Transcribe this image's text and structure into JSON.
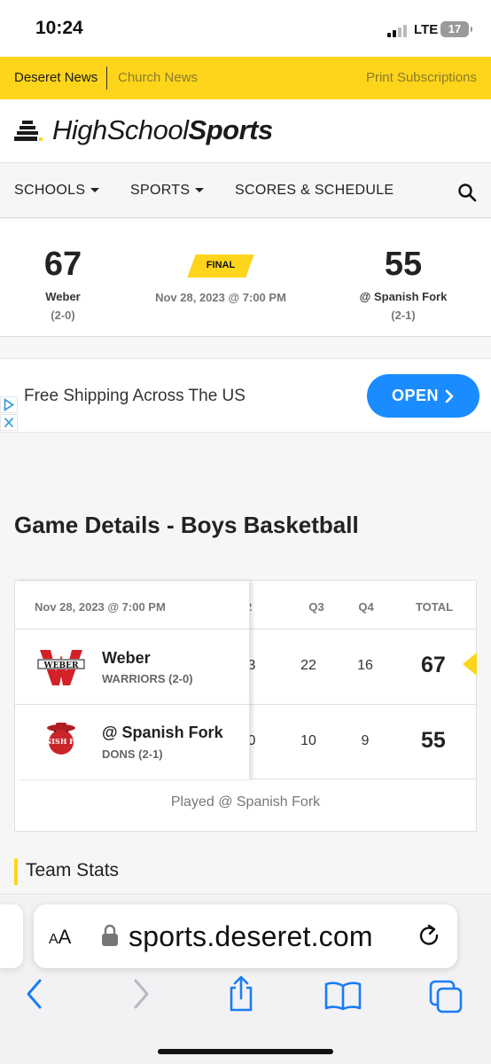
{
  "status_bar": {
    "time": "10:24",
    "network": "LTE",
    "battery": "17"
  },
  "top_links": {
    "deseret_news": "Deseret News",
    "church_news": "Church News",
    "print_subscriptions": "Print Subscriptions"
  },
  "logo": {
    "high_school": "HighSchool",
    "sports": "Sports"
  },
  "nav": {
    "schools": "SCHOOLS",
    "sports": "SPORTS",
    "scores": "SCORES & SCHEDULE"
  },
  "score_header": {
    "home": {
      "score": "67",
      "name": "Weber",
      "record": "(2-0)"
    },
    "away": {
      "score": "55",
      "name": "@ Spanish Fork",
      "record": "(2-1)"
    },
    "status": "FINAL",
    "date": "Nov 28, 2023 @ 7:00 PM"
  },
  "ad": {
    "text": "Free Shipping Across The US",
    "button": "OPEN"
  },
  "game_details": {
    "title": "Game Details - Boys Basketball",
    "table_date": "Nov 28, 2023 @ 7:00 PM",
    "columns": [
      "2",
      "Q3",
      "Q4",
      "TOTAL"
    ],
    "rows": [
      {
        "team": "Weber",
        "sub": "WARRIORS (2-0)",
        "logo_text": "WEBER",
        "q2_partial": "3",
        "q3": "22",
        "q4": "16",
        "total": "67"
      },
      {
        "team": "@ Spanish Fork",
        "sub": "DONS (2-1)",
        "logo_text": "SPANISH FORK",
        "q2_partial": "0",
        "q3": "10",
        "q4": "9",
        "total": "55"
      }
    ],
    "played_at": "Played @ Spanish Fork"
  },
  "team_stats": {
    "title": "Team Stats"
  },
  "safari": {
    "aa_big": "A",
    "aa_small": "A",
    "url": "sports.deseret.com"
  },
  "colors": {
    "brand_yellow": "#ffd51c",
    "ad_button_blue": "#1a8cff",
    "ios_blue": "#1a7cf5"
  }
}
